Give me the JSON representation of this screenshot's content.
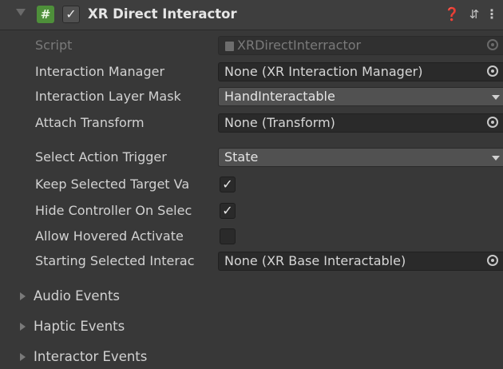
{
  "header": {
    "title": "XR Direct Interactor",
    "enabled_check": "✓",
    "component_icon": "hash-icon",
    "help_glyph": "❓",
    "preset_glyph": "⇵",
    "menu_glyph": "⋮"
  },
  "properties": [
    {
      "label": "Script",
      "kind": "object",
      "value": "XRDirectInterractor",
      "disabled": true
    },
    {
      "label": "Interaction Manager",
      "kind": "object",
      "value": "None (XR Interaction Manager)"
    },
    {
      "label": "Interaction Layer Mask",
      "kind": "dropdown",
      "value": "HandInteractable"
    },
    {
      "label": "Attach Transform",
      "kind": "object",
      "value": "None (Transform)"
    },
    {
      "label": "Select Action Trigger",
      "kind": "dropdown",
      "value": "State"
    },
    {
      "label": "Keep Selected Target Va",
      "kind": "toggle",
      "checked": true,
      "mark": "✓"
    },
    {
      "label": "Hide Controller On Selec",
      "kind": "toggle",
      "checked": true,
      "mark": "✓"
    },
    {
      "label": "Allow Hovered Activate",
      "kind": "toggle",
      "checked": false,
      "mark": ""
    },
    {
      "label": "Starting Selected Interac",
      "kind": "object",
      "value": "None (XR Base Interactable)"
    }
  ],
  "foldouts": [
    {
      "label": "Audio Events"
    },
    {
      "label": "Haptic Events"
    },
    {
      "label": "Interactor Events"
    }
  ]
}
